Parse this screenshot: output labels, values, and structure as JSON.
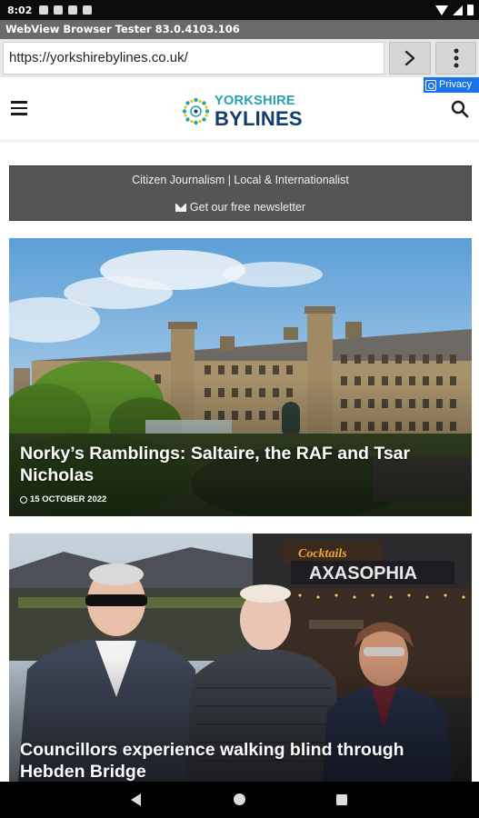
{
  "status_bar": {
    "time": "8:02"
  },
  "app": {
    "title": "WebView Browser Tester 83.0.4103.106"
  },
  "url_bar": {
    "url": "https://yorkshirebylines.co.uk/"
  },
  "privacy": {
    "label": "Privacy"
  },
  "site": {
    "logo_top": "YORKSHIRE",
    "logo_bottom": "BYLINES",
    "brand_colors": {
      "teal": "#21a3b1",
      "navy": "#123c6b"
    }
  },
  "banner": {
    "tagline": "Citizen Journalism | Local & Internationalist",
    "newsletter": "Get our free newsletter"
  },
  "articles": [
    {
      "title": "Norky’s Ramblings: Saltaire, the RAF and Tsar Nicholas",
      "date": "15 OCTOBER 2022"
    },
    {
      "title": "Councillors experience walking blind through Hebden Bridge"
    }
  ],
  "icons": [
    "hamburger-icon",
    "search-icon",
    "chevron-right-icon",
    "more-vert-icon",
    "envelope-icon",
    "clock-icon"
  ]
}
